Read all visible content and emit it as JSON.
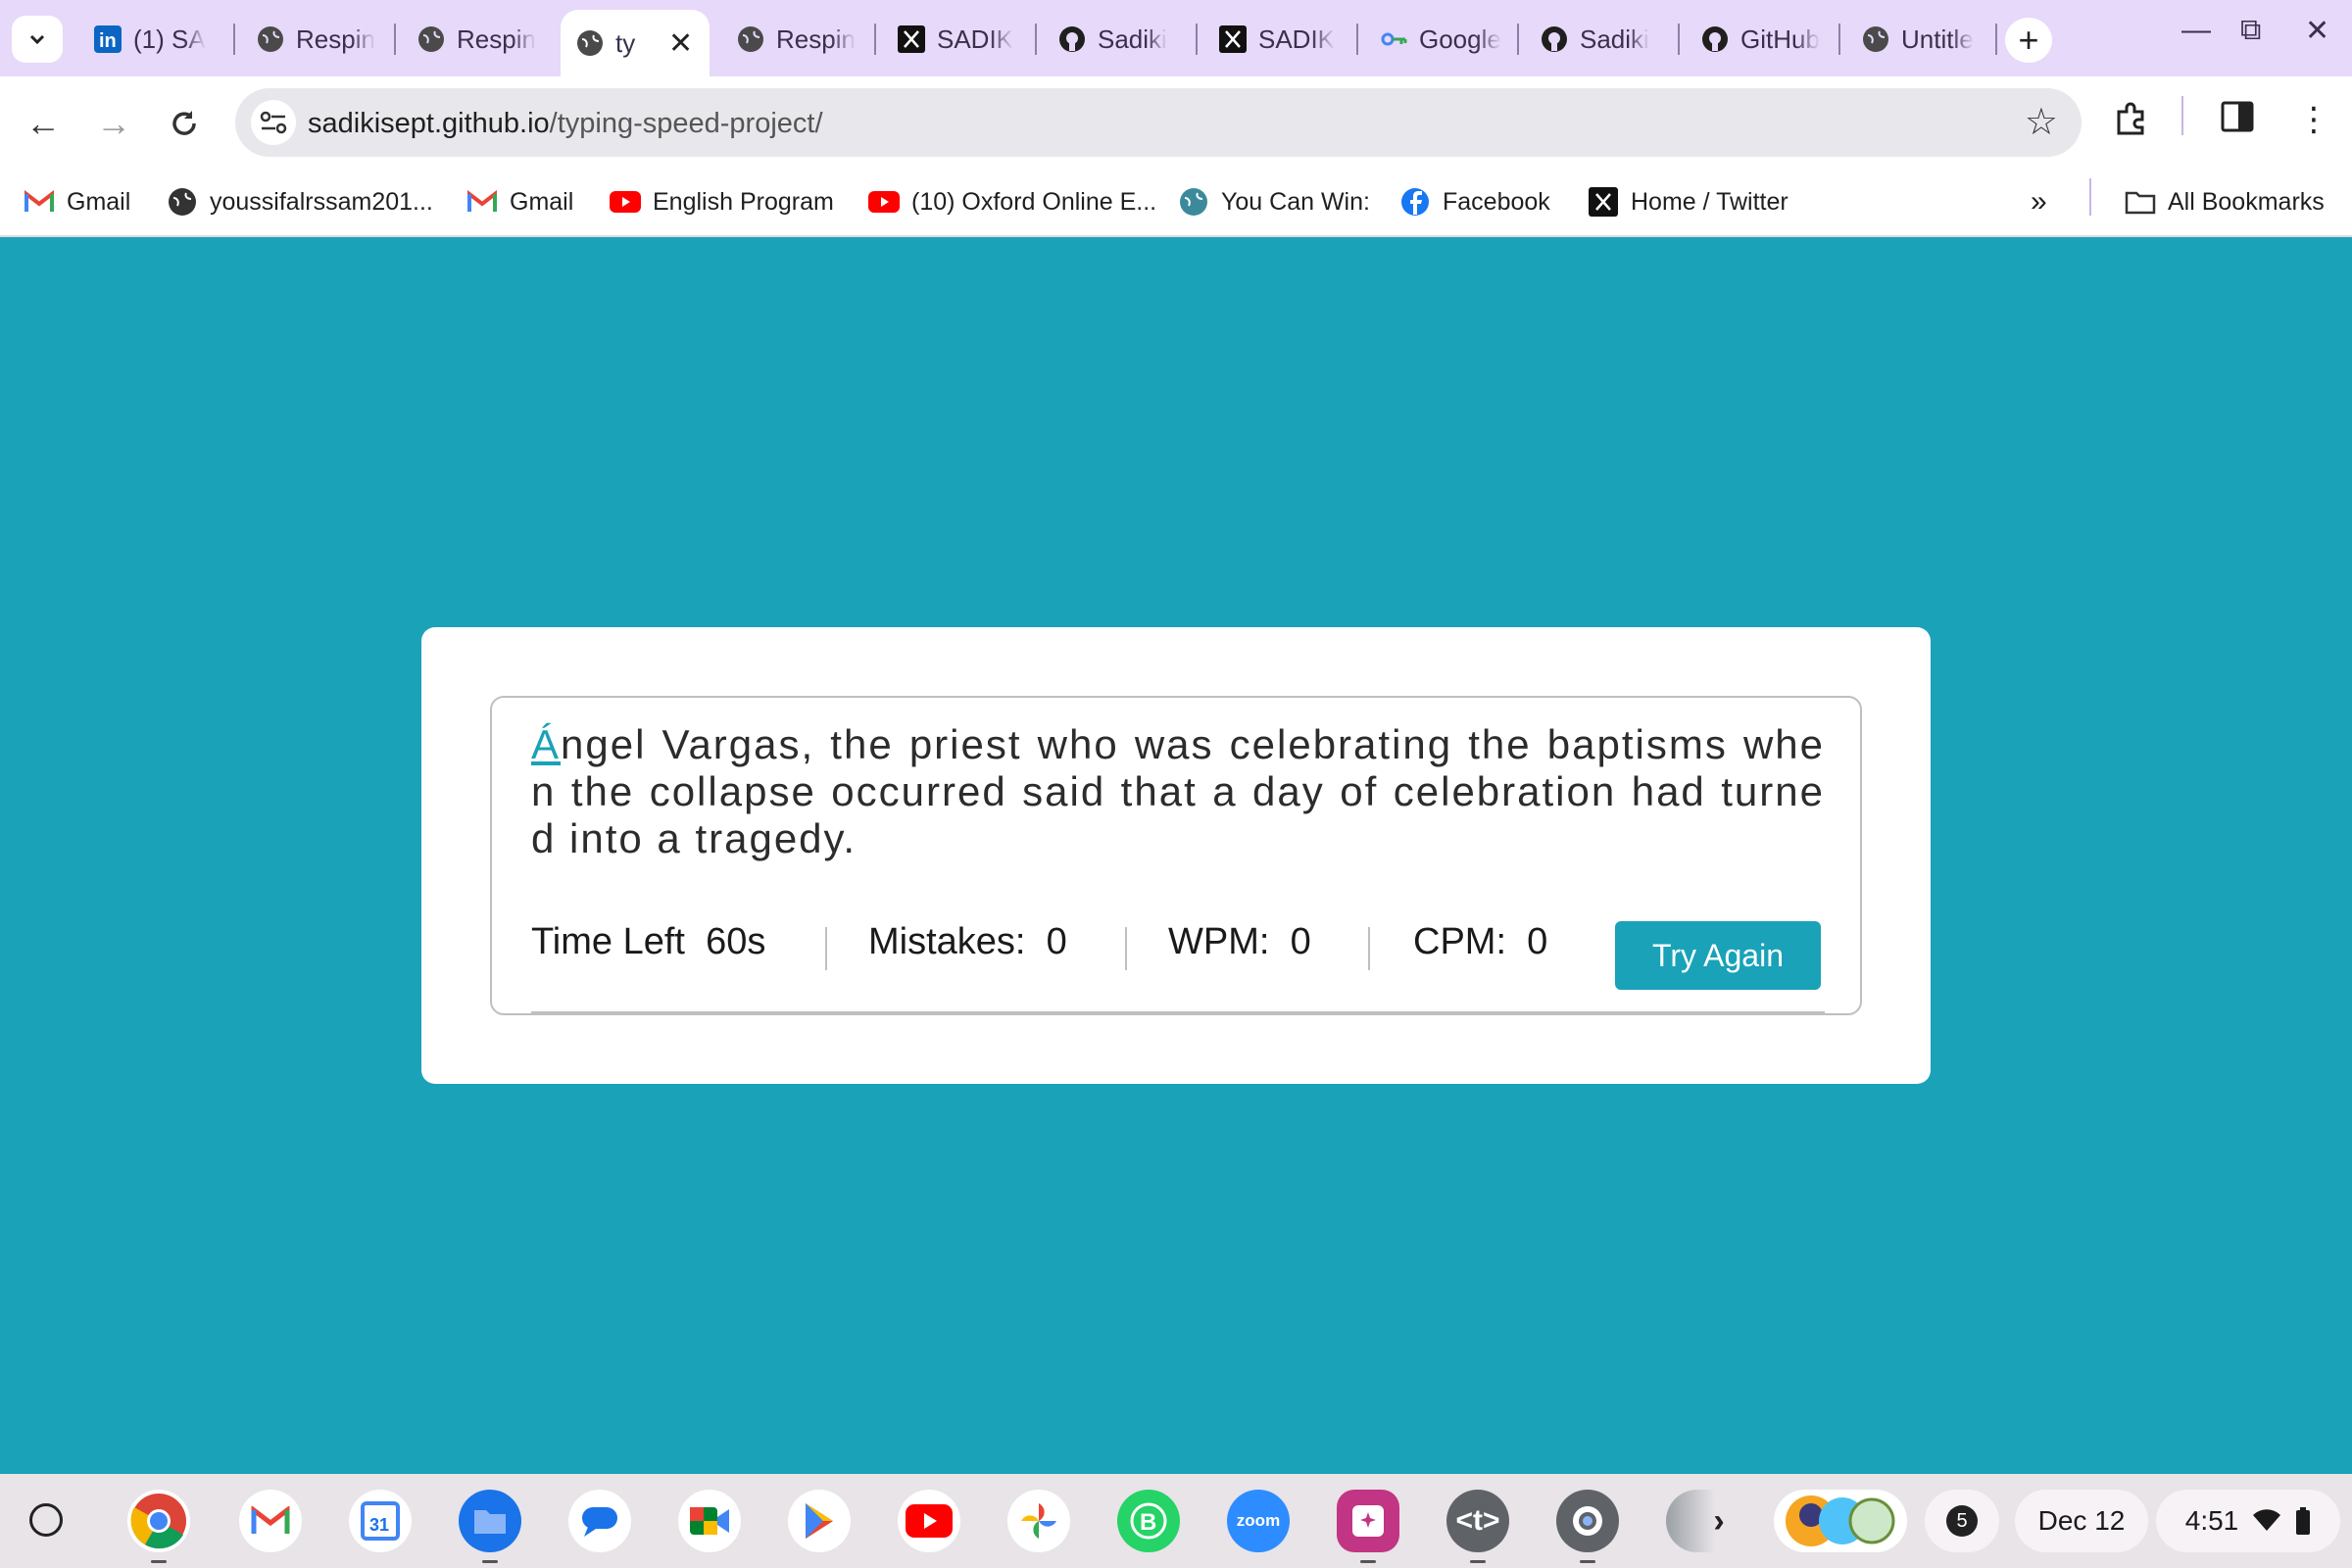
{
  "browser": {
    "tabs": [
      {
        "title": "(1) SA",
        "icon": "linkedin-icon"
      },
      {
        "title": "Respin",
        "icon": "globe-icon"
      },
      {
        "title": "Respin",
        "icon": "globe-icon"
      },
      {
        "title": "ty",
        "icon": "globe-icon",
        "active": true
      },
      {
        "title": "Respin",
        "icon": "globe-icon"
      },
      {
        "title": "SADIK",
        "icon": "x-icon"
      },
      {
        "title": "Sadiki",
        "icon": "github-icon"
      },
      {
        "title": "SADIK",
        "icon": "x-icon"
      },
      {
        "title": "Google",
        "icon": "key-icon"
      },
      {
        "title": "Sadiki",
        "icon": "github-icon"
      },
      {
        "title": "GitHub",
        "icon": "github-icon"
      },
      {
        "title": "Untitle",
        "icon": "globe-icon"
      }
    ],
    "url_domain": "sadikisept.github.io",
    "url_path": "/typing-speed-project/",
    "bookmarks": [
      {
        "label": "Gmail",
        "icon": "gmail-icon"
      },
      {
        "label": "youssifalrssam201...",
        "icon": "globe-icon"
      },
      {
        "label": "Gmail",
        "icon": "gmail-icon"
      },
      {
        "label": "English Program",
        "icon": "youtube-icon"
      },
      {
        "label": "(10) Oxford Online E...",
        "icon": "youtube-icon"
      },
      {
        "label": "You Can Win:",
        "icon": "globe-icon"
      },
      {
        "label": "Facebook",
        "icon": "facebook-icon"
      },
      {
        "label": "Home / Twitter",
        "icon": "x-icon"
      }
    ],
    "all_bookmarks": "All Bookmarks"
  },
  "typing": {
    "first_char": "Á",
    "rest_text": "ngel Vargas, the priest who was celebrating the baptisms when the collapse occurred said that a day of celebration had turned into a tragedy.",
    "time_label": "Time Left",
    "time_value": "60s",
    "mistakes_label": "Mistakes:",
    "mistakes_value": "0",
    "wpm_label": "WPM:",
    "wpm_value": "0",
    "cpm_label": "CPM:",
    "cpm_value": "0",
    "button_label": "Try Again",
    "accent_color": "#19a2b8"
  },
  "shelf": {
    "date": "Dec 12",
    "time": "4:51",
    "notification_count": "5",
    "apps": [
      "chrome",
      "gmail",
      "calendar",
      "files",
      "messages",
      "meet",
      "play-store",
      "youtube",
      "photos",
      "whatsapp-business",
      "zoom",
      "canvas",
      "text-editor",
      "settings"
    ],
    "calendar_day": "31",
    "zoom_label": "zoom"
  }
}
